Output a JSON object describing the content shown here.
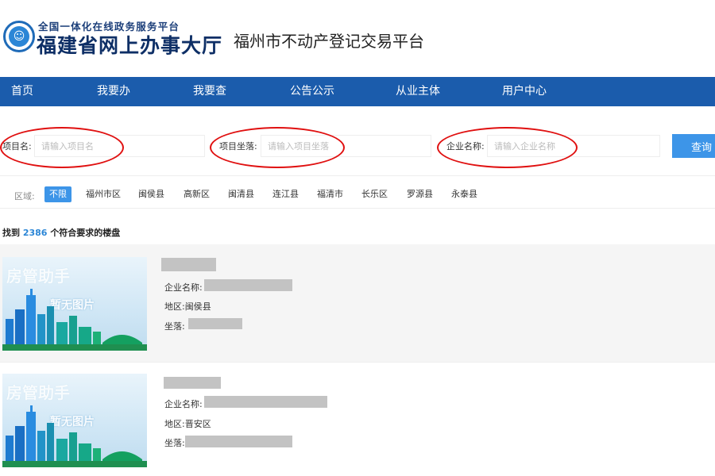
{
  "header": {
    "logo_line1": "全国一体化在线政务服务平台",
    "logo_line2": "福建省网上办事大厅",
    "site_title": "福州市不动产登记交易平台"
  },
  "nav": {
    "items": [
      "首页",
      "我要办",
      "我要查",
      "公告公示",
      "从业主体",
      "用户中心"
    ]
  },
  "search": {
    "project_name_label": "项目名:",
    "project_name_placeholder": "请输入项目名",
    "project_location_label": "项目坐落:",
    "project_location_placeholder": "请输入项目坐落",
    "company_name_label": "企业名称:",
    "company_name_placeholder": "请输入企业名称",
    "query_button": "查询"
  },
  "region_filter": {
    "label": "区域:",
    "options": [
      "不限",
      "福州市区",
      "闽侯县",
      "高新区",
      "闽清县",
      "连江县",
      "福清市",
      "长乐区",
      "罗源县",
      "永泰县"
    ],
    "selected": "不限"
  },
  "results": {
    "prefix": "找到",
    "count": "2386",
    "suffix": "个符合要求的楼盘"
  },
  "listings": [
    {
      "thumb_brand": "房管助手",
      "thumb_nopic": "暂无图片",
      "company_label": "企业名称:",
      "district_label": "地区:",
      "district": "闽侯县",
      "location_label": "坐落:"
    },
    {
      "thumb_brand": "房管助手",
      "thumb_nopic": "暂无图片",
      "company_label": "企业名称:",
      "district_label": "地区:",
      "district": "晋安区",
      "location_label": "坐落:"
    }
  ],
  "colors": {
    "nav_bg": "#1b5cac",
    "accent": "#3d95e8",
    "annotation": "#e01010",
    "redaction": "#c3c3c3"
  }
}
